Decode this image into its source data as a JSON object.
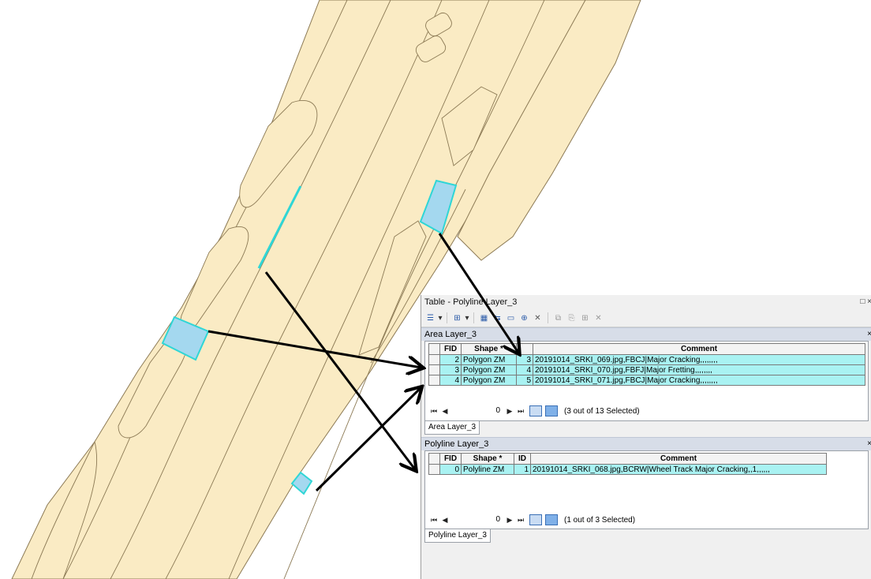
{
  "window": {
    "title": "Table - Polyline Layer_3",
    "restore_icon": "restore-icon",
    "close_icon": "close-icon"
  },
  "toolbar": {
    "icons": [
      "table-options-icon",
      "related-tables-icon",
      "select-by-attributes-icon",
      "switch-selection-icon",
      "clear-selection-icon",
      "zoom-to-selected-icon",
      "delete-selected-icon",
      "copy-icon",
      "paste-icon",
      "add-field-icon",
      "delete-field-icon"
    ]
  },
  "area_layer": {
    "header": "Area Layer_3",
    "columns": [
      "FID",
      "Shape *",
      "",
      "Comment"
    ],
    "rows": [
      {
        "fid": "2",
        "shape": "Polygon ZM",
        "id": "3",
        "comment": "20191014_SRKI_069.jpg,FBCJ|Major Cracking,,,,,,,,"
      },
      {
        "fid": "3",
        "shape": "Polygon ZM",
        "id": "4",
        "comment": "20191014_SRKI_070.jpg,FBFJ|Major Fretting,,,,,,,,"
      },
      {
        "fid": "4",
        "shape": "Polygon ZM",
        "id": "5",
        "comment": "20191014_SRKI_071.jpg,FBCJ|Major Cracking,,,,,,,,"
      }
    ],
    "nav": {
      "first": "⏮",
      "prev": "◀",
      "record": "0",
      "next": "▶",
      "last": "⏭"
    },
    "selection_text": "(3 out of 13 Selected)",
    "tab_label": "Area Layer_3"
  },
  "polyline_layer": {
    "header": "Polyline Layer_3",
    "columns": [
      "FID",
      "Shape *",
      "ID",
      "Comment"
    ],
    "rows": [
      {
        "fid": "0",
        "shape": "Polyline ZM",
        "id": "1",
        "comment": "20191014_SRKI_068.jpg,BCRW|Wheel Track Major Cracking,,1,,,,,,"
      }
    ],
    "nav": {
      "first": "⏮",
      "prev": "◀",
      "record": "0",
      "next": "▶",
      "last": "⏭"
    },
    "selection_text": "(1 out of 3 Selected)",
    "tab_label": "Polyline Layer_3"
  },
  "colors": {
    "road_fill": "#faebc4",
    "road_outline": "#8c7a55",
    "selected_fill": "#a4d8ef",
    "selected_outline": "#2fd6d6",
    "selected_row": "#a9f2f2"
  }
}
